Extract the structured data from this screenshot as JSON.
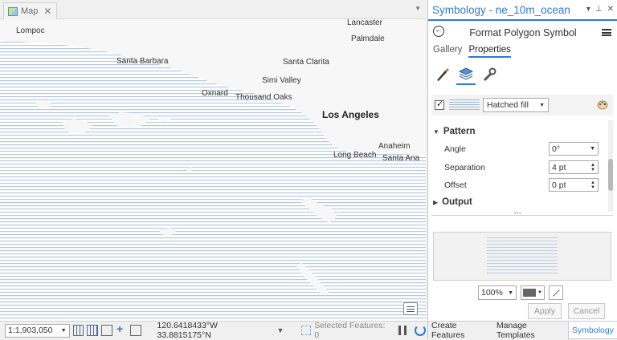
{
  "map": {
    "tab_label": "Map",
    "tab_close": "✕",
    "places": [
      {
        "name": "Lancaster",
        "major": false
      },
      {
        "name": "Lompoc",
        "major": false
      },
      {
        "name": "Palmdale",
        "major": false
      },
      {
        "name": "Santa Barbara",
        "major": false
      },
      {
        "name": "Santa Clarita",
        "major": false
      },
      {
        "name": "Simi Valley",
        "major": false
      },
      {
        "name": "Oxnard",
        "major": false
      },
      {
        "name": "Thousand Oaks",
        "major": false
      },
      {
        "name": "Los Angeles",
        "major": true
      },
      {
        "name": "Anaheim",
        "major": false
      },
      {
        "name": "Long Beach",
        "major": false
      },
      {
        "name": "Santa Ana",
        "major": false
      }
    ],
    "ocean_hatch_color": "#b7c9df"
  },
  "statusbar": {
    "scale": "1:1,903,050",
    "coordinates": "120.6418433°W 33.8815175°N",
    "selected_features": "Selected Features: 0"
  },
  "symbology": {
    "title": "Symbology - ne_10m_ocean",
    "header_controls": [
      "▾",
      "⊥",
      "✕"
    ],
    "format_title": "Format Polygon Symbol",
    "view_tabs": [
      "Gallery",
      "Properties"
    ],
    "active_view_tab": "Properties",
    "icon_tabs": [
      "brush-icon",
      "layers-icon",
      "wrench-icon"
    ],
    "layer_type": "Hatched fill",
    "sections": {
      "pattern": "Pattern",
      "output": "Output"
    },
    "properties": {
      "angle_label": "Angle",
      "angle_value": "0°",
      "separation_label": "Separation",
      "separation_value": "4 pt",
      "offset_label": "Offset",
      "offset_value": "0 pt"
    },
    "preview_zoom": "100%",
    "apply_label": "Apply",
    "cancel_label": "Cancel",
    "accent_color": "#2f7bd1"
  },
  "bottom_tabs": [
    "Create Features",
    "Manage Templates",
    "Symbology"
  ],
  "active_bottom_tab": "Symbology"
}
